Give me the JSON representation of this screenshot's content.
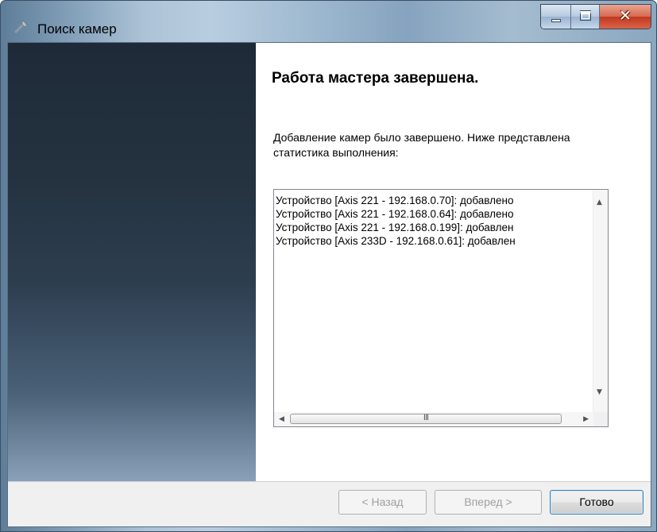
{
  "window": {
    "title": "Поиск камер",
    "app_icon": "wrench-icon",
    "buttons": {
      "minimize": "minimize-icon",
      "maximize": "maximize-icon",
      "close": "✕"
    }
  },
  "wizard": {
    "heading": "Работа мастера завершена.",
    "description": "Добавление камер было завершено. Ниже представлена статистика выполнения:",
    "statistics": [
      "Устройство [Axis 221 - 192.168.0.70]: добавлено",
      "Устройство [Axis 221 - 192.168.0.64]: добавлено",
      "Устройство [Axis 221 - 192.168.0.199]: добавлен",
      "Устройство [Axis 233D - 192.168.0.61]: добавлен"
    ],
    "scrollbar_grip": "III"
  },
  "buttons": {
    "back": {
      "label": "< Назад",
      "enabled": false
    },
    "next": {
      "label": "Вперед >",
      "enabled": false
    },
    "finish": {
      "label": "Готово",
      "enabled": true
    }
  },
  "colors": {
    "banner_top": "#1e2a38",
    "banner_bottom": "#8aa0b8",
    "close_button": "#c0391f"
  }
}
